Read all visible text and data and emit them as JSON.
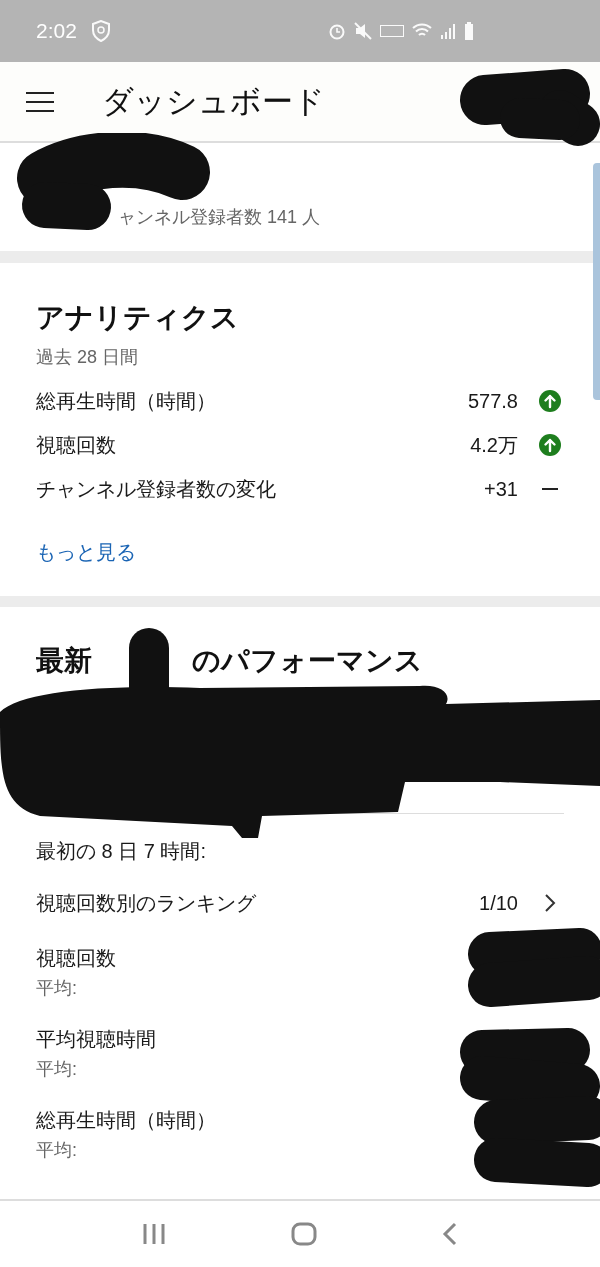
{
  "status_bar": {
    "time": "2:02"
  },
  "app_bar": {
    "title": "ダッシュボード"
  },
  "channel": {
    "subscribers": "ャンネル登録者数 141 人"
  },
  "analytics": {
    "title": "アナリティクス",
    "period": "過去 28 日間",
    "metrics": [
      {
        "label": "総再生時間（時間）",
        "value": "577.8",
        "trend_up": true
      },
      {
        "label": "視聴回数",
        "value": "4.2万",
        "trend_up": true
      },
      {
        "label": "チャンネル登録者数の変化",
        "value": "+31",
        "trend_up": false
      }
    ],
    "more_link": "もっと見る"
  },
  "performance": {
    "title_parts": [
      "最新",
      "のパフォーマンス"
    ],
    "period": "最初の 8 日 7 時間:",
    "ranking": {
      "label": "視聴回数別のランキング",
      "value": "1/10"
    },
    "metrics": [
      {
        "label": "視聴回数",
        "sub": "平均:"
      },
      {
        "label": "平均視聴時間",
        "sub": "平均:"
      },
      {
        "label": "総再生時間（時間）",
        "sub": "平均:"
      }
    ]
  }
}
